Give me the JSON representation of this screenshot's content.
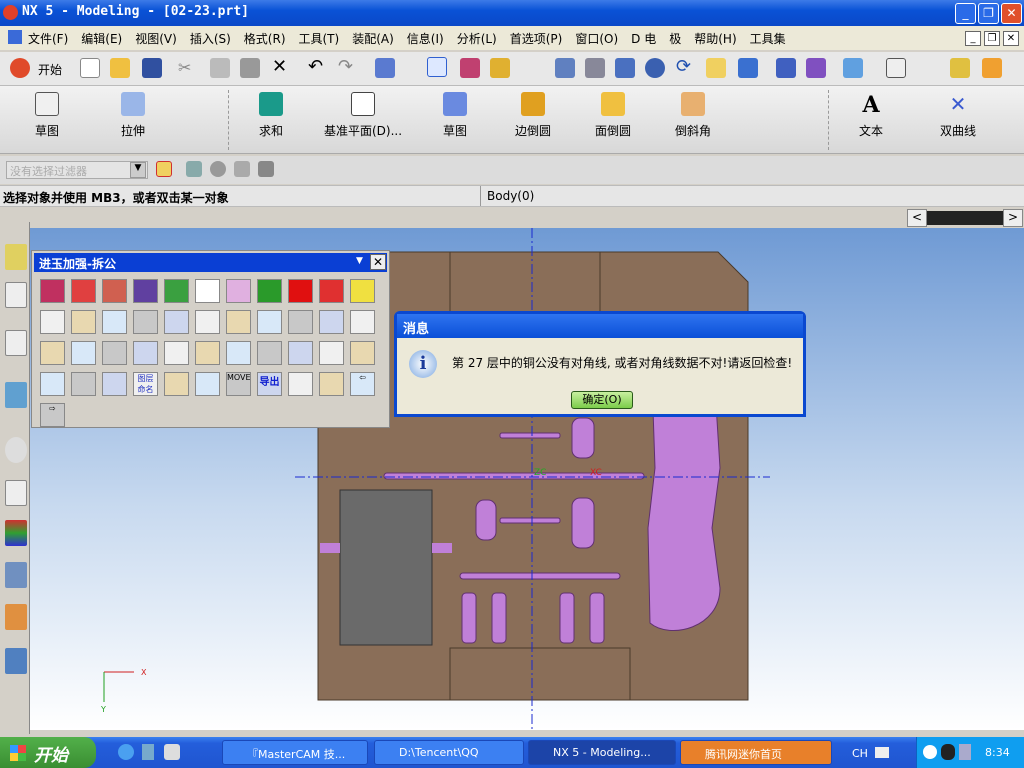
{
  "window": {
    "title": "NX 5 - Modeling - [02-23.prt]"
  },
  "menu": [
    "文件(F)",
    "编辑(E)",
    "视图(V)",
    "插入(S)",
    "格式(R)",
    "工具(T)",
    "装配(A)",
    "信息(I)",
    "分析(L)",
    "首选项(P)",
    "窗口(O)",
    "D 电",
    "极",
    "帮助(H)",
    "工具集"
  ],
  "toolbar1": {
    "start_label": "开始"
  },
  "toolbar2": {
    "items": [
      "草图",
      "拉伸",
      "求和",
      "基准平面(D)...",
      "草图",
      "边倒圆",
      "面倒圆",
      "倒斜角",
      "文本",
      "双曲线"
    ]
  },
  "filter": {
    "placeholder": "没有选择过滤器"
  },
  "status": {
    "prompt": "选择对象并使用 MB3，或者双击某一对象",
    "selection": "Body(0)"
  },
  "palette": {
    "title": "进玉加强-拆公",
    "icons": [
      "frame-icon",
      "hatch-icon",
      "block-icon",
      "surface-icon",
      "wire-box-icon",
      "cylinder-icon",
      "plane-icon",
      "line-icon",
      "red-square-icon",
      "red-box-icon",
      "yellow-box-icon",
      "bone-icon",
      "electrode-icon",
      "bracket-icon",
      "split-green-icon",
      "split-icon",
      "split2-icon",
      "cut-box-icon",
      "blue-blob-icon",
      "blank-icon",
      "pocket-icon",
      "profile-icon",
      "circles-icon",
      "wave-icon",
      "cross-icon",
      "wire-frame-icon",
      "gear-box-icon",
      "funnel-icon",
      "overlap-icon",
      "insert-icon",
      "text-edit-icon",
      "font-icon",
      "grid-icon",
      "crosshair-icon",
      "diagonal-icon",
      "xyz-icon",
      "layer-name-icon",
      "delete-shape-icon",
      "arrow-gray-icon",
      "move-icon",
      "export-icon",
      "map-icon",
      "print-icon",
      "arrow-left-icon",
      "arrow-right-icon"
    ],
    "layer_name_text": "图层命名",
    "export_text": "导出",
    "move_text": "MOVE"
  },
  "dialog": {
    "title": "消息",
    "message": "第 27 层中的铜公没有对角线, 或者对角线数据不对!请返回检查!",
    "ok_label": "确定(O)"
  },
  "viewport": {
    "axis_labels": {
      "x": "X",
      "y": "Y",
      "zc": "ZC",
      "xc": "XC"
    }
  },
  "taskbar": {
    "start_label": "开始",
    "tasks": [
      "『MasterCAM 技...",
      "D:\\Tencent\\QQ",
      "NX 5 - Modeling...",
      "腾讯网迷你首页"
    ],
    "lang": "CH",
    "clock": "8:34"
  },
  "colors": {
    "accent": "#0a48d0",
    "model": "#8a6e58",
    "part": "#c080d8",
    "taskbar": "#245edb"
  }
}
